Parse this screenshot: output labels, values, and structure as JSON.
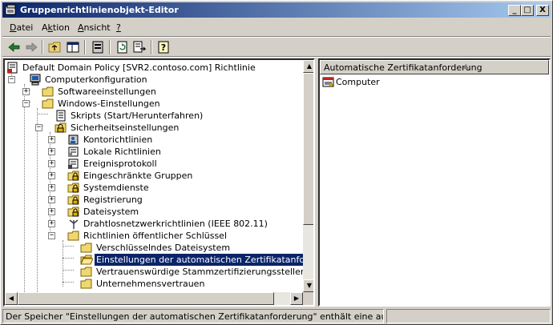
{
  "window": {
    "title": "Gruppenrichtlinienobjekt-Editor",
    "controls": {
      "minimize": "_",
      "maximize": "□",
      "close": "X"
    }
  },
  "menu": {
    "items": [
      {
        "label": "Datei",
        "accel": "D"
      },
      {
        "label": "Aktion",
        "accel": "k"
      },
      {
        "label": "Ansicht",
        "accel": "A"
      },
      {
        "label": "?",
        "accel": "?"
      }
    ]
  },
  "toolbar": {
    "buttons": [
      {
        "icon": "back-arrow-icon"
      },
      {
        "icon": "forward-arrow-icon"
      },
      {
        "icon": "up-folder-icon"
      },
      {
        "icon": "show-hide-tree-icon"
      },
      {
        "icon": "properties-icon"
      },
      {
        "icon": "refresh-icon"
      },
      {
        "icon": "export-list-icon"
      },
      {
        "icon": "help-icon"
      }
    ]
  },
  "tree": {
    "items": [
      {
        "label": "Default Domain Policy [SVR2.contoso.com] Richtlinie",
        "icon": "policy-icon",
        "expander": ""
      },
      {
        "label": "Computerkonfiguration",
        "icon": "computer-icon",
        "expander": "-"
      },
      {
        "label": "Softwareeinstellungen",
        "icon": "folder-icon",
        "expander": "+"
      },
      {
        "label": "Windows-Einstellungen",
        "icon": "folder-icon",
        "expander": "-"
      },
      {
        "label": "Skripts (Start/Herunterfahren)",
        "icon": "script-icon",
        "expander": ""
      },
      {
        "label": "Sicherheitseinstellungen",
        "icon": "security-icon",
        "expander": "-"
      },
      {
        "label": "Kontorichtlinien",
        "icon": "account-policy-icon",
        "expander": "+"
      },
      {
        "label": "Lokale Richtlinien",
        "icon": "local-policy-icon",
        "expander": "+"
      },
      {
        "label": "Ereignisprotokoll",
        "icon": "event-log-icon",
        "expander": "+"
      },
      {
        "label": "Eingeschränkte Gruppen",
        "icon": "lock-folder-icon",
        "expander": "+"
      },
      {
        "label": "Systemdienste",
        "icon": "lock-folder-icon",
        "expander": "+"
      },
      {
        "label": "Registrierung",
        "icon": "lock-folder-icon",
        "expander": "+"
      },
      {
        "label": "Dateisystem",
        "icon": "lock-folder-icon",
        "expander": "+"
      },
      {
        "label": "Drahtlosnetzwerkrichtlinien (IEEE 802.11)",
        "icon": "wireless-antenna-icon",
        "expander": "+"
      },
      {
        "label": "Richtlinien öffentlicher Schlüssel",
        "icon": "folder-icon",
        "expander": "-"
      },
      {
        "label": "Verschlüsselndes Dateisystem",
        "icon": "folder-icon",
        "expander": ""
      },
      {
        "label": "Einstellungen der automatischen Zertifikatanforderung",
        "icon": "folder-open-icon",
        "expander": "",
        "selected": true
      },
      {
        "label": "Vertrauenswürdige Stammzertifizierungsstellen",
        "icon": "folder-icon",
        "expander": ""
      },
      {
        "label": "Unternehmensvertrauen",
        "icon": "folder-icon",
        "expander": ""
      }
    ]
  },
  "list": {
    "column": "Automatische Zertifikatanforderung",
    "items": [
      {
        "label": "Computer",
        "icon": "certificate-request-icon"
      }
    ]
  },
  "status": {
    "text": "Der Speicher \"Einstellungen der automatischen Zertifikatanforderung\" enthält eine automatische Zertifi"
  },
  "colors": {
    "titlebar_start": "#0a246a",
    "titlebar_end": "#a6caf0",
    "selection": "#0a246a",
    "face": "#d4d0c8"
  }
}
